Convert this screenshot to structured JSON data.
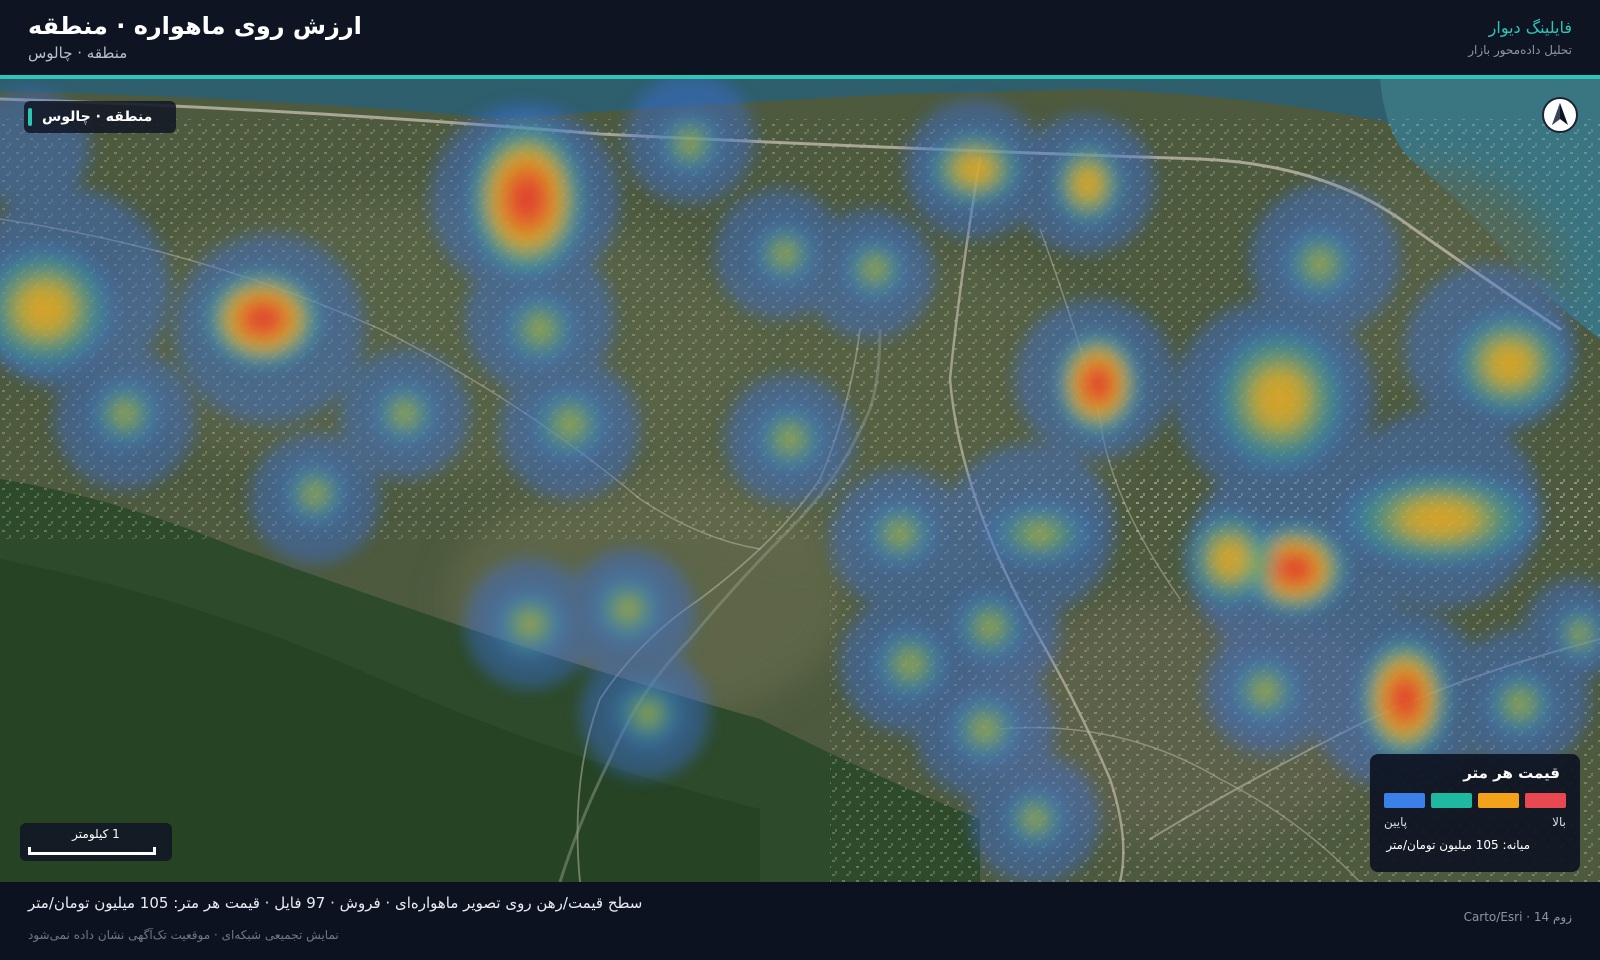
{
  "header": {
    "title": "ارزش روی ماهواره · منطقه",
    "subtitle": "منطقه · چالوس",
    "brand_name": "فایلینگ دیوار",
    "brand_tagline": "تحلیل داده‌محور بازار"
  },
  "map": {
    "region_label": "منطقه · چالوس",
    "compass_icon": "north-arrow-icon",
    "scale_label": "1 کیلومتر",
    "accent_color": "#2ec4b6",
    "heat_points": [
      {
        "id": "hs-01",
        "intensity": 1.0
      },
      {
        "id": "hs-02",
        "intensity": 0.85
      },
      {
        "id": "hs-03",
        "intensity": 0.8
      },
      {
        "id": "hs-04",
        "intensity": 0.85
      },
      {
        "id": "hs-05",
        "intensity": 0.9
      },
      {
        "id": "hs-06",
        "intensity": 0.9
      },
      {
        "id": "hs-07",
        "intensity": 0.85
      },
      {
        "id": "hs-08",
        "intensity": 0.6
      },
      {
        "id": "hs-09",
        "intensity": 0.65
      },
      {
        "id": "hs-10",
        "intensity": 0.55
      },
      {
        "id": "hs-11",
        "intensity": 0.55
      },
      {
        "id": "hs-12",
        "intensity": 0.6
      },
      {
        "id": "hs-13",
        "intensity": 0.7
      },
      {
        "id": "hs-14",
        "intensity": 0.6
      }
    ]
  },
  "legend": {
    "title": "قیمت هر متر",
    "colors": [
      "#e84850",
      "#f5a21b",
      "#1fb8a0",
      "#3b7fe8"
    ],
    "high_label": "بالا",
    "low_label": "پایین",
    "median_label": "میانه: 105 میلیون تومان/متر"
  },
  "footer": {
    "summary": "سطح قیمت/رهن روی تصویر ماهواره‌ای · فروش · 97 فایل · قیمت هر متر: 105 میلیون تومان/متر",
    "note": "نمایش تجمیعی شبکه‌ای · موقعیت تک‌آگهی نشان داده نمی‌شود",
    "meta": "زوم 14 · Carto/Esri"
  }
}
